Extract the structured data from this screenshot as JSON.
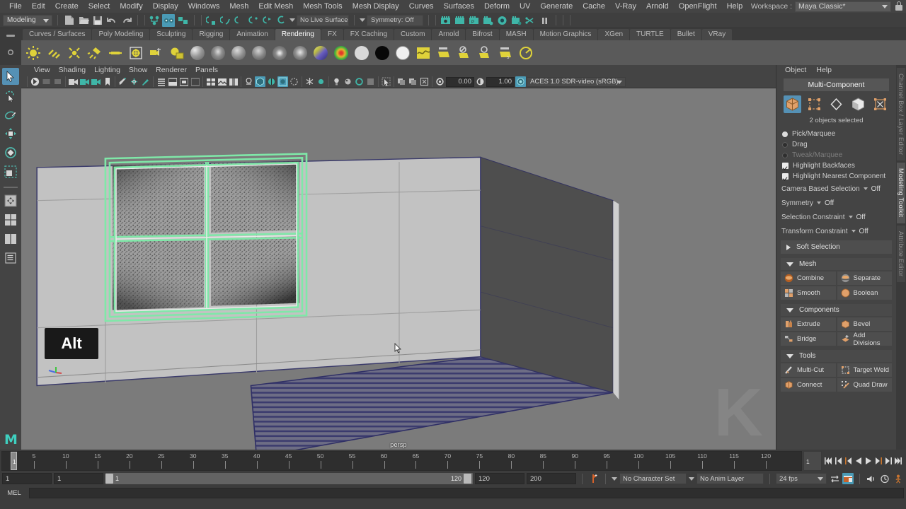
{
  "menubar": {
    "items": [
      "File",
      "Edit",
      "Create",
      "Select",
      "Modify",
      "Display",
      "Windows",
      "Mesh",
      "Edit Mesh",
      "Mesh Tools",
      "Mesh Display",
      "Curves",
      "Surfaces",
      "Deform",
      "UV",
      "Generate",
      "Cache",
      "V-Ray",
      "Arnold",
      "OpenFlight",
      "Help"
    ],
    "workspace_label": "Workspace :",
    "workspace_value": "Maya Classic*"
  },
  "statusbar": {
    "selection_mode": "Modeling",
    "live_surface": "No Live Surface",
    "symmetry": "Symmetry: Off"
  },
  "shelf": {
    "tabs": [
      "Curves / Surfaces",
      "Poly Modeling",
      "Sculpting",
      "Rigging",
      "Animation",
      "Rendering",
      "FX",
      "FX Caching",
      "Custom",
      "Arnold",
      "Bifrost",
      "MASH",
      "Motion Graphics",
      "XGen",
      "TURTLE",
      "Bullet",
      "VRay"
    ],
    "active_tab": "Rendering"
  },
  "toolbox": {
    "tools": [
      "select-tool",
      "lasso-select-tool",
      "paint-select-tool",
      "move-tool",
      "rotate-tool",
      "scale-tool",
      "last-tool",
      "snap-grid-tool",
      "four-view-layout",
      "two-pane-layout",
      "outliner-layout"
    ]
  },
  "viewport": {
    "menus": [
      "View",
      "Shading",
      "Lighting",
      "Show",
      "Renderer",
      "Panels"
    ],
    "exposure": "0.00",
    "gamma": "1.00",
    "color_space": "ACES 1.0 SDR-video (sRGB)",
    "camera_label": "persp",
    "key_overlay": "Alt",
    "watermark": "K"
  },
  "right_panel": {
    "menus": [
      "Object",
      "Help"
    ],
    "title": "Multi-Component",
    "mode_icons": [
      "object-mode-icon",
      "vertex-mode-icon",
      "edge-mode-icon",
      "face-mode-icon",
      "uv-mode-icon"
    ],
    "selection_count": "2 objects selected",
    "radios": [
      {
        "label": "Pick/Marquee",
        "on": true,
        "dim": false
      },
      {
        "label": "Drag",
        "on": false,
        "dim": false
      },
      {
        "label": "Tweak/Marquee",
        "on": false,
        "dim": true
      }
    ],
    "checks": [
      {
        "label": "Highlight Backfaces",
        "on": true
      },
      {
        "label": "Highlight Nearest Component",
        "on": true
      }
    ],
    "options": [
      {
        "label": "Camera Based Selection",
        "value": "Off"
      },
      {
        "label": "Symmetry",
        "value": "Off"
      },
      {
        "label": "Selection Constraint",
        "value": "Off"
      },
      {
        "label": "Transform Constraint",
        "value": "Off"
      }
    ],
    "soft_selection": "Soft Selection",
    "sections": [
      {
        "title": "Mesh",
        "buttons": [
          {
            "label": "Combine",
            "icon": "combine-icon"
          },
          {
            "label": "Separate",
            "icon": "separate-icon"
          },
          {
            "label": "Smooth",
            "icon": "smooth-icon"
          },
          {
            "label": "Boolean",
            "icon": "boolean-icon"
          }
        ]
      },
      {
        "title": "Components",
        "buttons": [
          {
            "label": "Extrude",
            "icon": "extrude-icon"
          },
          {
            "label": "Bevel",
            "icon": "bevel-icon"
          },
          {
            "label": "Bridge",
            "icon": "bridge-icon"
          },
          {
            "label": "Add Divisions",
            "icon": "add-divisions-icon"
          }
        ]
      },
      {
        "title": "Tools",
        "buttons": [
          {
            "label": "Multi-Cut",
            "icon": "multi-cut-icon"
          },
          {
            "label": "Target Weld",
            "icon": "target-weld-icon"
          },
          {
            "label": "Connect",
            "icon": "connect-icon"
          },
          {
            "label": "Quad Draw",
            "icon": "quad-draw-icon"
          }
        ]
      }
    ],
    "vertical_tabs": [
      {
        "label": "Channel Box / Layer Editor",
        "active": false
      },
      {
        "label": "Modeling Toolkit",
        "active": true
      },
      {
        "label": "Attribute Editor",
        "active": false
      }
    ]
  },
  "timeline": {
    "ticks": [
      5,
      10,
      15,
      20,
      25,
      30,
      35,
      40,
      45,
      50,
      55,
      60,
      65,
      70,
      75,
      80,
      85,
      90,
      95,
      100,
      105,
      110,
      115,
      120
    ],
    "current_frame": "1",
    "current_frame_field": "1",
    "range_start_field": "1",
    "range_slider_start": "1",
    "range_slider_end": "120",
    "range_end_field": "120",
    "anim_end_field": "200",
    "character_set": "No Character Set",
    "anim_layer": "No Anim Layer",
    "fps": "24 fps",
    "playback_buttons": [
      "go-to-start",
      "step-back-key",
      "step-back-frame",
      "play-backwards",
      "play-forwards",
      "step-forward-frame",
      "step-forward-key",
      "go-to-end"
    ]
  },
  "commandline": {
    "language": "MEL",
    "input_value": ""
  },
  "colors": {
    "accent_blue": "#5591b5",
    "highlight_green": "#7fe8a8",
    "window_bg": "#444444",
    "viewport_bg": "#7b7b7b",
    "wall_light": "#c2c2c2",
    "wall_dark": "#4e4e4e",
    "floor_grid": "#5b5b8f"
  }
}
